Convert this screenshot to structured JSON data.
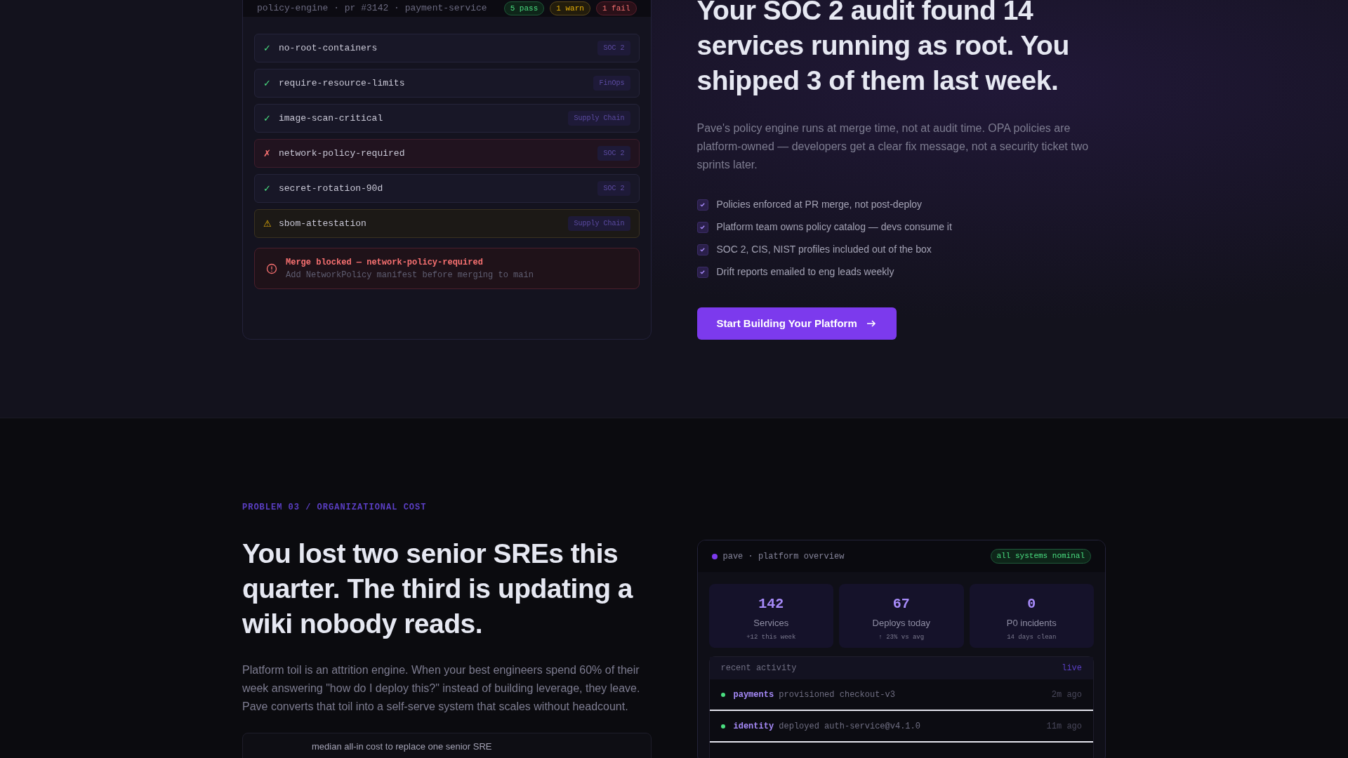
{
  "policy_panel": {
    "header": "policy-engine · pr #3142 · payment-service",
    "badges": [
      {
        "label": "5 pass",
        "kind": "pass"
      },
      {
        "label": "1 warn",
        "kind": "warn"
      },
      {
        "label": "1 fail",
        "kind": "fail"
      }
    ],
    "checks": [
      {
        "name": "no-root-containers",
        "kind": "pass",
        "icon": "✓",
        "tag": "SOC 2"
      },
      {
        "name": "require-resource-limits",
        "kind": "pass",
        "icon": "✓",
        "tag": "FinOps"
      },
      {
        "name": "image-scan-critical",
        "kind": "pass",
        "icon": "✓",
        "tag": "Supply Chain"
      },
      {
        "name": "network-policy-required",
        "kind": "fail",
        "icon": "✗",
        "tag": "SOC 2"
      },
      {
        "name": "secret-rotation-90d",
        "kind": "pass",
        "icon": "✓",
        "tag": "SOC 2"
      },
      {
        "name": "sbom-attestation",
        "kind": "warn",
        "icon": "⚠",
        "tag": "Supply Chain"
      }
    ],
    "alert": {
      "title": "Merge blocked — network-policy-required",
      "detail": "Add NetworkPolicy manifest before merging to main"
    }
  },
  "soc_section": {
    "heading": "Your SOC 2 audit found 14 services running as root. You shipped 3 of them last week.",
    "body": "Pave's policy engine runs at merge time, not at audit time. OPA policies are platform-owned — developers get a clear fix message, not a security ticket two sprints later.",
    "checklist": [
      {
        "label": "Policies enforced at PR merge, not post-deploy",
        "checked": true
      },
      {
        "label": "Platform team owns policy catalog — devs consume it",
        "checked": true
      },
      {
        "label": "SOC 2, CIS, NIST profiles included out of the box",
        "checked": true
      },
      {
        "label": "Drift reports emailed to eng leads weekly",
        "checked": true
      }
    ],
    "cta": "Start Building Your Platform"
  },
  "problem_section": {
    "eyebrow": "PROBLEM 03 / ORGANIZATIONAL COST",
    "heading": "You lost two senior SREs this quarter. The third is updating a wiki nobody reads.",
    "body": "Platform toil is an attrition engine. When your best engineers spend 60% of their week answering \"how do I deploy this?\" instead of building leverage, they leave. Pave converts that toil into a self-serve system that scales without headcount.",
    "stat_card": {
      "caption": "median all-in cost to replace one senior SRE"
    }
  },
  "dashboard": {
    "title": "pave · platform overview",
    "status": "all systems nominal",
    "stats": [
      {
        "value": "142",
        "label": "Services",
        "sub": "+12 this week"
      },
      {
        "value": "67",
        "label": "Deploys today",
        "sub": "↑ 23% vs avg"
      },
      {
        "value": "0",
        "label": "P0 incidents",
        "sub": "14 days clean"
      }
    ],
    "activity": {
      "title": "recent activity",
      "live": "live",
      "rows": [
        {
          "team": "payments",
          "action": "provisioned checkout-v3",
          "time": "2m ago",
          "color": "#4ade80"
        },
        {
          "team": "identity",
          "action": "deployed auth-service@v4.1.0",
          "time": "11m ago",
          "color": "#4ade80"
        }
      ]
    }
  }
}
